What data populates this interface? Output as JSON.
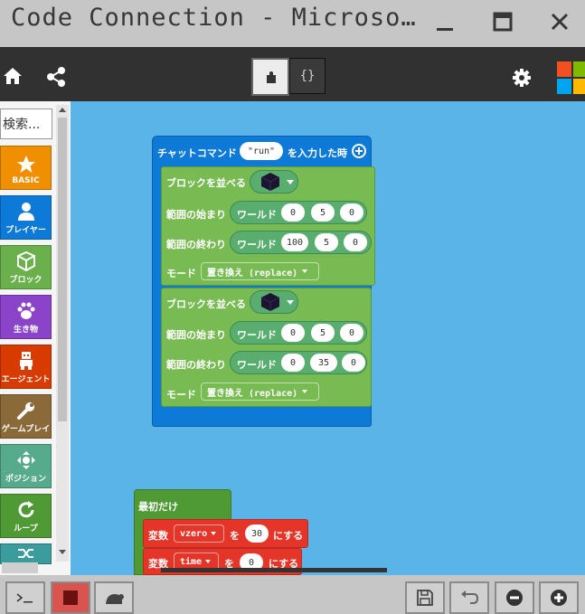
{
  "window": {
    "title": "Code Connection - Microso…"
  },
  "toolbar": {
    "code_mode_label": "{}"
  },
  "palette": {
    "search_placeholder": "検索...",
    "categories": [
      {
        "label": "BASIC",
        "color": "#f09000"
      },
      {
        "label": "プレイヤー",
        "color": "#0d7ad8"
      },
      {
        "label": "ブロック",
        "color": "#6ab04c"
      },
      {
        "label": "生き物",
        "color": "#8b44c9"
      },
      {
        "label": "エージェント",
        "color": "#d73b00"
      },
      {
        "label": "ゲームプレイ",
        "color": "#8b6a3a"
      },
      {
        "label": "ポジション",
        "color": "#56ab8c"
      },
      {
        "label": "ループ",
        "color": "#4f9a35"
      },
      {
        "label": "",
        "color": "#3a9c9c"
      }
    ]
  },
  "workspace": {
    "chat_block": {
      "label": "チャットコマンド",
      "command": "\"run\"",
      "suffix": "を入力した時",
      "color": "#0d7ad8"
    },
    "fill_blocks": [
      {
        "label": "ブロックを並べる",
        "start_label": "範囲の始まり",
        "end_label": "範囲の終わり",
        "world_label": "ワールド",
        "start": [
          "0",
          "5",
          "0"
        ],
        "end": [
          "100",
          "5",
          "0"
        ],
        "mode_label": "モード",
        "mode_value": "置き換え (replace)"
      },
      {
        "label": "ブロックを並べる",
        "start_label": "範囲の始まり",
        "end_label": "範囲の終わり",
        "world_label": "ワールド",
        "start": [
          "0",
          "5",
          "0"
        ],
        "end": [
          "0",
          "35",
          "0"
        ],
        "mode_label": "モード",
        "mode_value": "置き換え (replace)"
      }
    ],
    "on_start_block": {
      "label": "最初だけ",
      "color": "#4f9a35"
    },
    "var_blocks": [
      {
        "label": "変数",
        "name": "vzero",
        "to": "を",
        "value": "30",
        "suffix": "にする"
      },
      {
        "label": "変数",
        "name": "time",
        "to": "を",
        "value": "0",
        "suffix": "にする"
      }
    ]
  },
  "colors": {
    "accent_blue": "#0d7ad8",
    "block_green": "#78bb53",
    "variable_red": "#e53529",
    "workspace_bg": "#5ab4e8",
    "titlebar": "#c6c6c6"
  }
}
